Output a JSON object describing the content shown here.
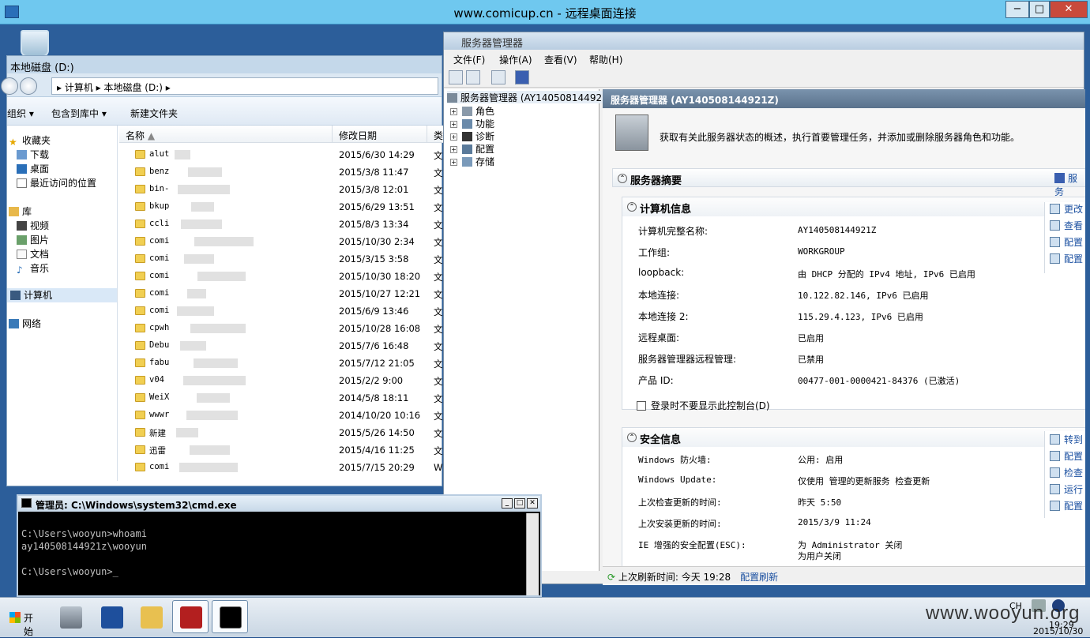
{
  "rdp": {
    "title": "www.comicup.cn - 远程桌面连接",
    "min": "−",
    "max": "□",
    "close": "✕"
  },
  "explorer": {
    "title": "本地磁盘 (D:)",
    "breadcrumb": "▸ 计算机 ▸ 本地磁盘 (D:) ▸",
    "toolbar": {
      "organize": "组织 ▾",
      "include": "包含到库中 ▾",
      "newfolder": "新建文件夹"
    },
    "nav": {
      "favorites": "收藏夹",
      "downloads": "下载",
      "desktop": "桌面",
      "recent": "最近访问的位置",
      "libraries": "库",
      "videos": "视频",
      "pictures": "图片",
      "docs": "文档",
      "music": "音乐",
      "computer": "计算机",
      "network": "网络"
    },
    "columns": {
      "name": "名称",
      "modified": "修改日期",
      "type": "类"
    },
    "files": [
      {
        "name": "alut",
        "date": "2015/6/30 14:29",
        "type": "文"
      },
      {
        "name": "benz",
        "date": "2015/3/8 11:47",
        "type": "文"
      },
      {
        "name": "bin-",
        "date": "2015/3/8 12:01",
        "type": "文"
      },
      {
        "name": "bkup",
        "date": "2015/6/29 13:51",
        "type": "文"
      },
      {
        "name": "ccli",
        "date": "2015/8/3 13:34",
        "type": "文"
      },
      {
        "name": "comi",
        "date": "2015/10/30 2:34",
        "type": "文"
      },
      {
        "name": "comi",
        "date": "2015/3/15 3:58",
        "type": "文"
      },
      {
        "name": "comi",
        "date": "2015/10/30 18:20",
        "type": "文"
      },
      {
        "name": "comi",
        "date": "2015/10/27 12:21",
        "type": "文"
      },
      {
        "name": "comi",
        "date": "2015/6/9 13:46",
        "type": "文"
      },
      {
        "name": "cpwh",
        "date": "2015/10/28 16:08",
        "type": "文"
      },
      {
        "name": "Debu",
        "date": "2015/7/6 16:48",
        "type": "文"
      },
      {
        "name": "fabu",
        "date": "2015/7/12 21:05",
        "type": "文"
      },
      {
        "name": "v04",
        "date": "2015/2/2 9:00",
        "type": "文"
      },
      {
        "name": "WeiX",
        "date": "2014/5/8 18:11",
        "type": "文"
      },
      {
        "name": "wwwr",
        "date": "2014/10/20 10:16",
        "type": "文"
      },
      {
        "name": "新建",
        "date": "2015/5/26 14:50",
        "type": "文"
      },
      {
        "name": "迅雷",
        "date": "2015/4/16 11:25",
        "type": "文"
      },
      {
        "name": "comi",
        "date": "2015/7/15 20:29",
        "type": "Wi"
      }
    ]
  },
  "srv": {
    "title": "服务器管理器",
    "menu": {
      "file": "文件(F)",
      "action": "操作(A)",
      "view": "查看(V)",
      "help": "帮助(H)"
    },
    "tree": {
      "root": "服务器管理器 (AY140508144921",
      "roles": "角色",
      "features": "功能",
      "diag": "诊断",
      "config": "配置",
      "storage": "存储"
    },
    "header": "服务器管理器 (AY140508144921Z)",
    "desc": "获取有关此服务器状态的概述，执行首要管理任务，并添加或删除服务器角色和功能。",
    "summary": "服务器摘要",
    "summary_link": "服务",
    "comp": {
      "title": "计算机信息",
      "rows": [
        {
          "k": "计算机完整名称:",
          "v": "AY140508144921Z"
        },
        {
          "k": "工作组:",
          "v": "WORKGROUP"
        },
        {
          "k": "loopback:",
          "v": "由 DHCP 分配的 IPv4 地址, IPv6 已启用"
        },
        {
          "k": "本地连接:",
          "v": "10.122.82.146, IPv6 已启用"
        },
        {
          "k": "本地连接 2:",
          "v": "115.29.4.123, IPv6 已启用"
        },
        {
          "k": "远程桌面:",
          "v": "已启用"
        },
        {
          "k": "服务器管理器远程管理:",
          "v": "已禁用"
        },
        {
          "k": "产品 ID:",
          "v": "00477-001-0000421-84376 (已激活)"
        }
      ],
      "checkbox": "登录时不要显示此控制台(D)",
      "actions": [
        "更改",
        "查看",
        "配置",
        "配置"
      ]
    },
    "sec": {
      "title": "安全信息",
      "rows": [
        {
          "k": "Windows 防火墙:",
          "v": "公用: 启用"
        },
        {
          "k": "Windows Update:",
          "v": "仅使用 管理的更新服务 检查更新"
        },
        {
          "k": "上次检查更新的时间:",
          "v": "昨天 5:50"
        },
        {
          "k": "上次安装更新的时间:",
          "v": "2015/3/9 11:24"
        },
        {
          "k": "IE 增强的安全配置(ESC):",
          "v": "为 Administrator 关闭"
        },
        {
          "k": "",
          "v": "为用户关闭"
        }
      ],
      "actions": [
        "转到",
        "配置",
        "检查",
        "运行",
        "配置"
      ]
    },
    "status": "上次刷新时间: 今天 19:28",
    "status_link": "配置刷新"
  },
  "cmd": {
    "title": "管理员: C:\\Windows\\system32\\cmd.exe",
    "body": "\nC:\\Users\\wooyun>whoami\nay140508144921z\\wooyun\n\nC:\\Users\\wooyun>_"
  },
  "taskbar": {
    "start": "开始",
    "lang": "CH",
    "time": "19:29",
    "date": "2015/10/30"
  },
  "watermark": "www.wooyun.org"
}
